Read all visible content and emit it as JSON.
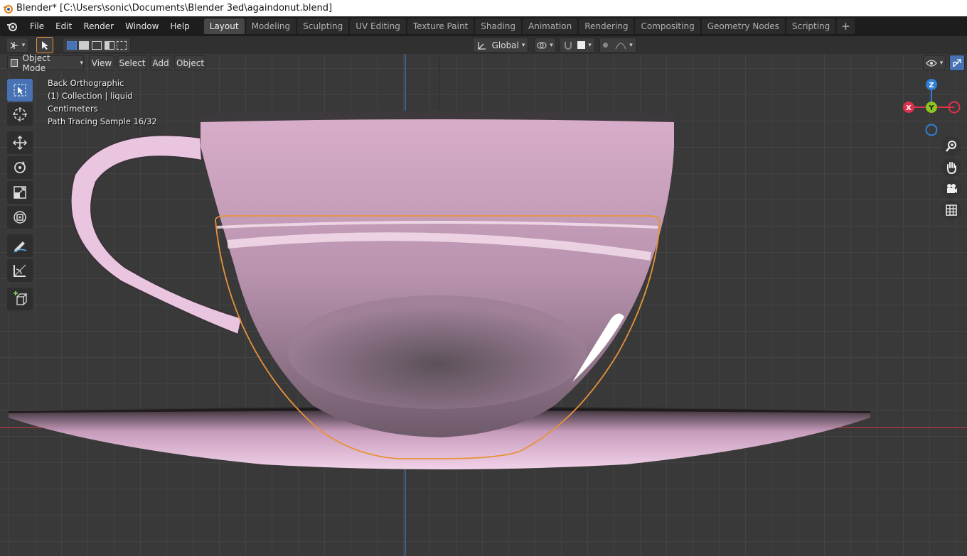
{
  "window": {
    "title": "Blender* [C:\\Users\\sonic\\Documents\\Blender 3ed\\againdonut.blend]"
  },
  "menu": [
    "File",
    "Edit",
    "Render",
    "Window",
    "Help"
  ],
  "workspaces": {
    "tabs": [
      "Layout",
      "Modeling",
      "Sculpting",
      "UV Editing",
      "Texture Paint",
      "Shading",
      "Animation",
      "Rendering",
      "Compositing",
      "Geometry Nodes",
      "Scripting"
    ],
    "active": "Layout",
    "add_label": "+"
  },
  "tool_header": {
    "transform_orientation": "Global"
  },
  "viewport_header": {
    "mode": "Object Mode",
    "menus": [
      "View",
      "Select",
      "Add",
      "Object"
    ]
  },
  "overlay": {
    "view_name": "Back Orthographic",
    "collection": "(1) Collection | liquid",
    "units": "Centimeters",
    "render_status": "Path Tracing Sample 16/32"
  },
  "gizmo": {
    "z": "Z",
    "y": "Y",
    "x": "X"
  },
  "icons": {
    "blender": "blender-logo-icon",
    "select_box": "select-box-icon",
    "cursor": "cursor-icon",
    "move": "move-icon",
    "rotate": "rotate-icon",
    "scale": "scale-icon",
    "transform": "transform-icon",
    "annotate": "annotate-icon",
    "measure": "measure-icon",
    "add_cube": "add-cube-icon",
    "zoom": "zoom-icon",
    "hand": "hand-pan-icon",
    "camera": "camera-icon",
    "grid": "grid-ortho-icon"
  },
  "colors": {
    "accent": "#4772b3",
    "selection_outline": "#e8923a",
    "axis_x": "#e0314c",
    "axis_y": "#8bc51f",
    "axis_z": "#2f7fd6"
  }
}
